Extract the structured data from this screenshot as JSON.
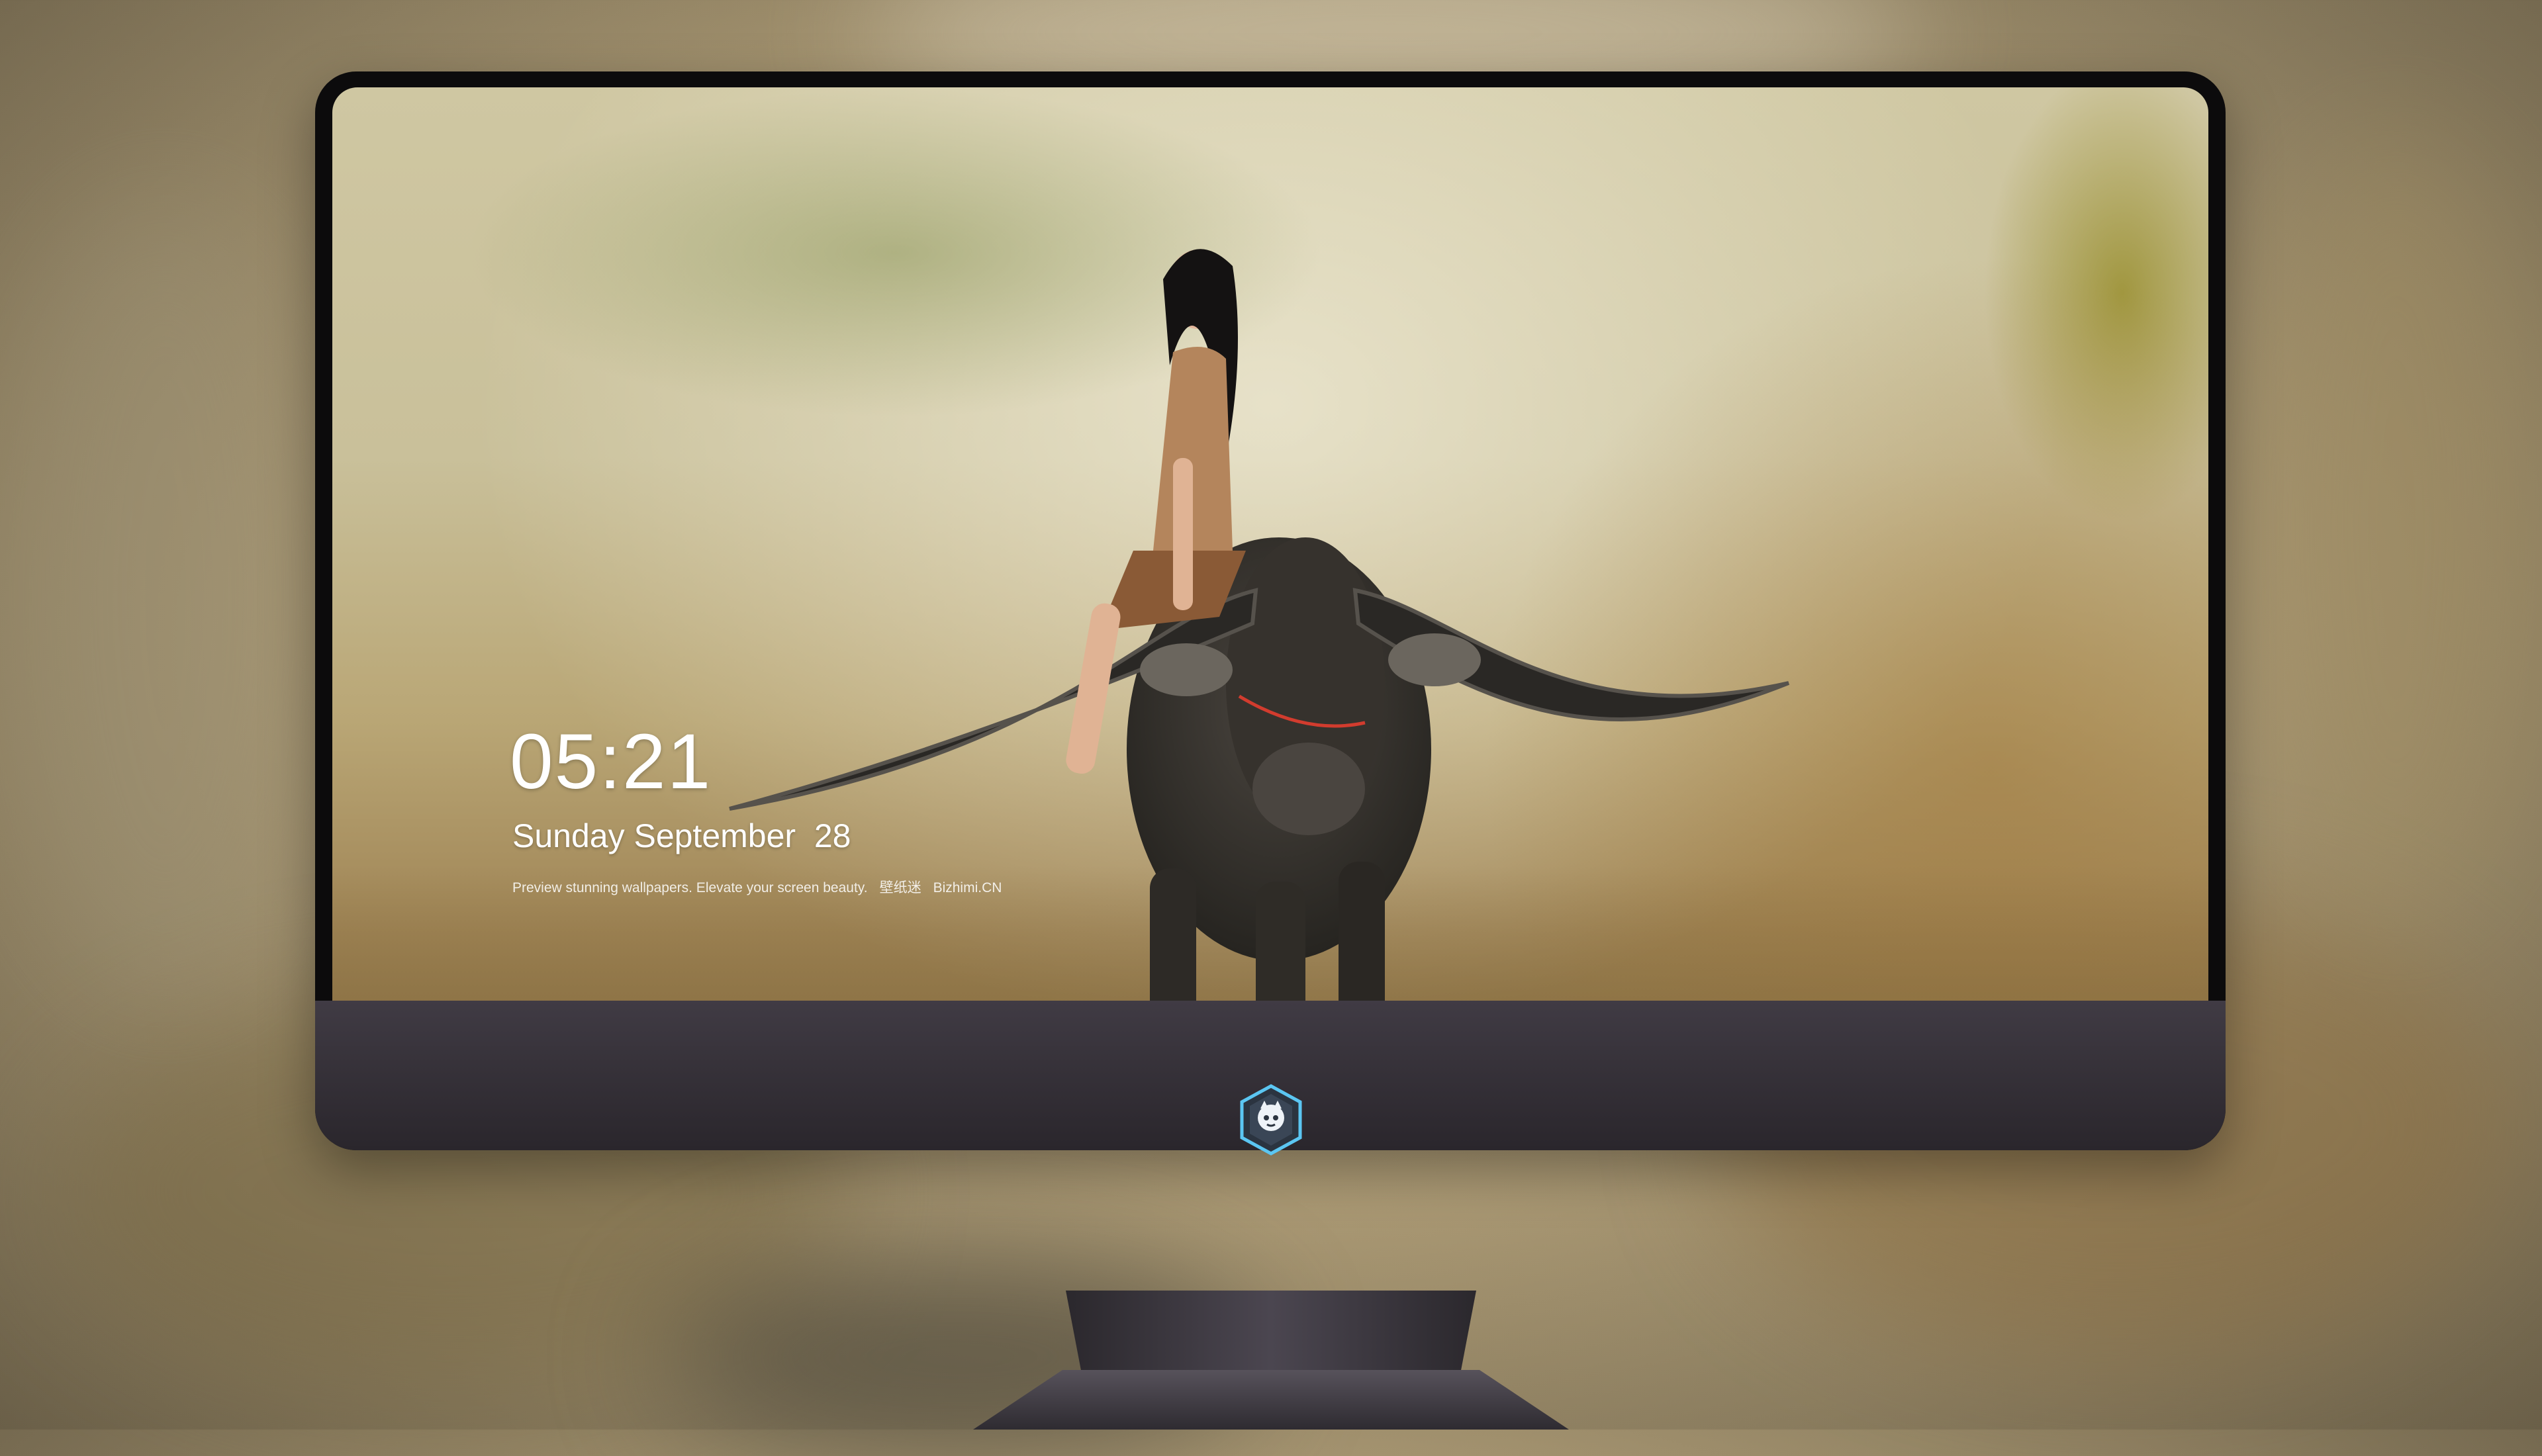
{
  "lock_screen": {
    "time": "05:21",
    "date": "Sunday September  28",
    "caption": {
      "text": "Preview stunning wallpapers. Elevate your screen beauty.",
      "cn": "壁纸迷",
      "brand": "Bizhimi.CN"
    }
  },
  "dock": {
    "apps": [
      {
        "name": "messages-icon",
        "color": "#34c759"
      },
      {
        "name": "weather-icon",
        "color": "#2f8ef5"
      },
      {
        "name": "clock-icon",
        "color": "#1c1c1e"
      },
      {
        "name": "preview-icon",
        "color": "#e9eef5"
      },
      {
        "name": "clips-icon",
        "color": "#5ac8fa"
      },
      {
        "name": "notes-icon",
        "color": "#ffd60a"
      },
      {
        "name": "photo-booth-icon",
        "color": "#f2f2f2"
      },
      {
        "name": "music-icon",
        "color": "#ff5ecf"
      },
      {
        "name": "app-store-icon",
        "color": "#1e90ff"
      },
      {
        "name": "camera-icon",
        "color": "#8e8e93"
      }
    ]
  },
  "monitor": {
    "logo": "wallpaper-app-logo-icon"
  }
}
